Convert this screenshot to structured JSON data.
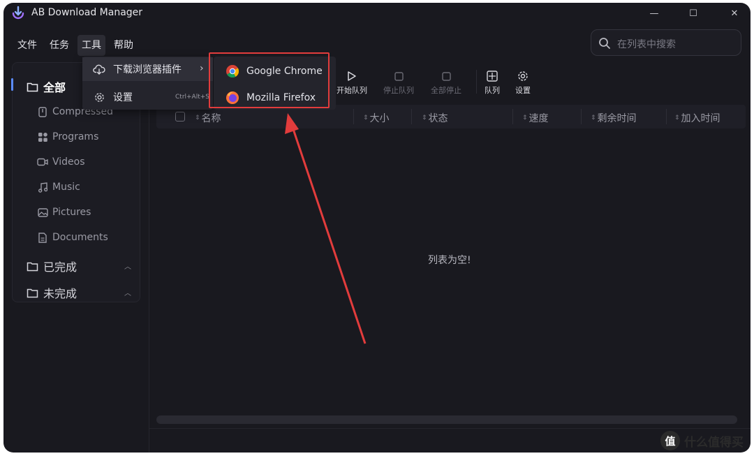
{
  "app": {
    "title": "AB Download Manager"
  },
  "window_controls": {
    "minimize": "—",
    "maximize": "☐",
    "close": "✕"
  },
  "menubar": {
    "items": [
      {
        "label": "文件"
      },
      {
        "label": "任务"
      },
      {
        "label": "工具"
      },
      {
        "label": "帮助"
      }
    ]
  },
  "search": {
    "placeholder": "在列表中搜索"
  },
  "sidebar": {
    "all": "全部",
    "subcategories": [
      {
        "label": "Compressed"
      },
      {
        "label": "Programs"
      },
      {
        "label": "Videos"
      },
      {
        "label": "Music"
      },
      {
        "label": "Pictures"
      },
      {
        "label": "Documents"
      }
    ],
    "completed": "已完成",
    "unfinished": "未完成"
  },
  "toolbar": {
    "start_queue": "开始队列",
    "stop_queue": "停止队列",
    "stop_all": "全部停止",
    "queue": "队列",
    "settings": "设置"
  },
  "table": {
    "columns": [
      {
        "label": "名称"
      },
      {
        "label": "大小"
      },
      {
        "label": "状态"
      },
      {
        "label": "速度"
      },
      {
        "label": "剩余时间"
      },
      {
        "label": "加入时间"
      }
    ],
    "empty_text": "列表为空!"
  },
  "tools_menu": {
    "browser_extension": "下载浏览器插件",
    "settings": "设置",
    "settings_shortcut": "Ctrl+Alt+S"
  },
  "browser_submenu": {
    "chrome": "Google Chrome",
    "firefox": "Mozilla Firefox"
  },
  "watermark": {
    "text": "什么值得买",
    "logo": "值"
  },
  "colors": {
    "accent": "#5b8cff",
    "highlight_box": "#e23c3c",
    "background": "#19191f"
  }
}
